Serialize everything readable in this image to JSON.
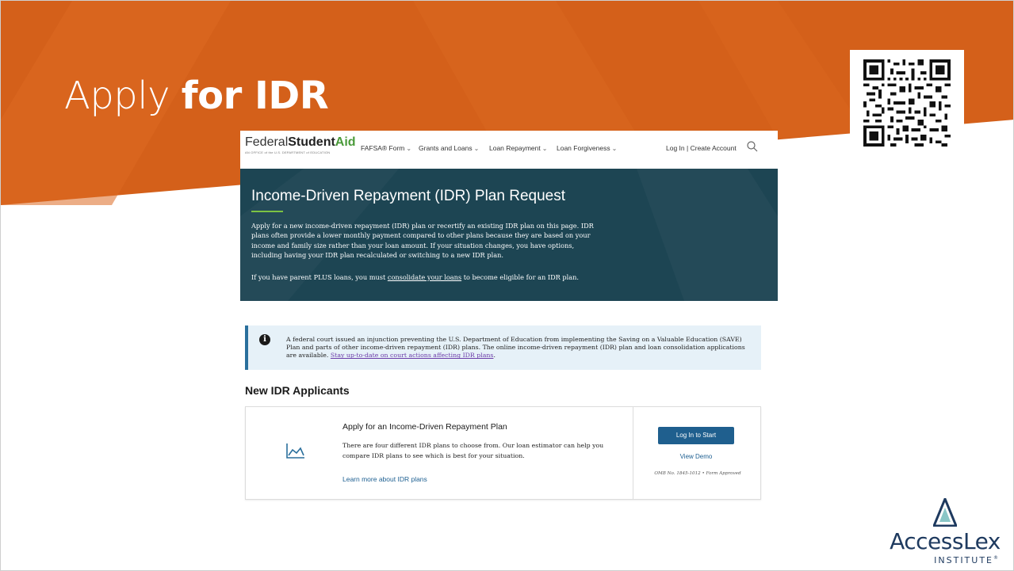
{
  "slide": {
    "title_light": "Apply ",
    "title_bold": "for IDR",
    "banner_color": "#d4601a",
    "logo_word": "AccessLex",
    "logo_sub": "INSTITUTE",
    "logo_trademark": "®"
  },
  "fsa_nav": {
    "logo_federal": "Federal",
    "logo_student": "Student",
    "logo_aid": "Aid",
    "tagline": "AN OFFICE of the U.S. DEPARTMENT of EDUCATION",
    "items": [
      {
        "label": "FAFSA® Form",
        "chevron": "⌄"
      },
      {
        "label": "Grants and Loans",
        "chevron": "⌄"
      },
      {
        "label": "Loan Repayment",
        "chevron": "⌄"
      },
      {
        "label": "Loan Forgiveness",
        "chevron": "⌄"
      }
    ],
    "login": "Log In",
    "separator": "|",
    "create_account": "Create Account",
    "search_icon": "search-icon"
  },
  "hero": {
    "title": "Income-Driven Repayment (IDR) Plan Request",
    "paragraph": "Apply for a new income-driven repayment (IDR) plan or recertify an existing IDR plan on this page. IDR plans often provide a lower monthly payment compared to other plans because they are based on your income and family size rather than your loan amount. If your situation changes, you have options, including having your IDR plan recalculated or switching to a new IDR plan.",
    "plus_before": "If you have parent PLUS loans, you must ",
    "plus_link": "consolidate your loans",
    "plus_after": " to become eligible for an IDR plan."
  },
  "alert": {
    "icon": "i",
    "text": "A federal court issued an injunction preventing the U.S. Department of Education from implementing the Saving on a Valuable Education (SAVE) Plan and parts of other income-driven repayment (IDR) plans. The online income-driven repayment (IDR) plan and loan consolidation applications are available. ",
    "link": "Stay up-to-date on court actions affecting IDR plans",
    "end": "."
  },
  "section": {
    "title": "New IDR Applicants"
  },
  "card": {
    "title": "Apply for an Income-Driven Repayment Plan",
    "text": "There are four different IDR plans to choose from. Our loan estimator can help you compare IDR plans to see which is best for your situation.",
    "learn_more": "Learn more about IDR plans",
    "login_button": "Log In to Start",
    "view_demo": "View Demo",
    "omb": "OMB No. 1845-1012  •  Form Approved",
    "icon": "chart-icon"
  }
}
